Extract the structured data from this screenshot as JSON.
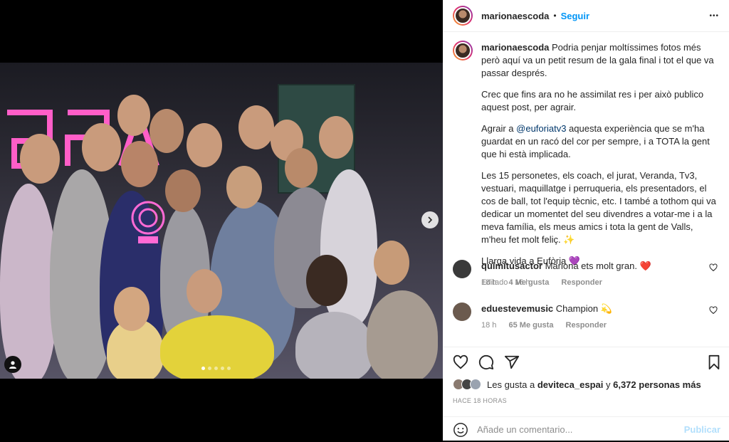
{
  "post": {
    "username": "marionaescoda",
    "dot": "•",
    "follow_label": "Seguir",
    "more_label": "•••"
  },
  "caption": {
    "username": "marionaescoda",
    "p1": "Podria penjar moltíssimes fotos més però aquí va un petit resum de la gala final i tot el que va passar després.",
    "p2": "Crec que fins ara no he assimilat res i per això publico aquest post, per agrair.",
    "p3_pre": "Agrair a ",
    "p3_link": "@euforiatv3",
    "p3_post": " aquesta experiència que se m'ha guardat en un racó del cor per sempre, i a TOTA la gent que hi està implicada.",
    "p4": "Les 15 personetes, els coach, el jurat, Veranda, Tv3, vestuari, maquillatge i perruqueria, els presentadors, el cos de ball, tot l'equip tècnic, etc. I també a tothom qui va dedicar un momentet del seu divendres a votar-me i a la meva família, els meus amics i tota la gent de Valls, m'heu fet molt feliç. ✨",
    "p5": "Llarga vida a Eufòria 💜",
    "edited": "Editado · 16 h"
  },
  "comments": [
    {
      "username": "quimitusactor",
      "text": "Mariona ets molt gran. ❤️",
      "time": "18 h",
      "likes": "4 Me gusta",
      "reply": "Responder",
      "avatar_color": "#3a3a3a"
    },
    {
      "username": "eduestevemusic",
      "text": "Champion 💫",
      "time": "18 h",
      "likes": "65 Me gusta",
      "reply": "Responder",
      "avatar_color": "#6b5a4e"
    }
  ],
  "likes_row": {
    "prefix": "Les gusta a ",
    "user": "deviteca_espai",
    "mid": " y ",
    "count": "6,372 personas más"
  },
  "timestamp": "HACE 18 HORAS",
  "add_comment": {
    "placeholder": "Añade un comentario...",
    "publish": "Publicar"
  },
  "icons": {
    "like": "heart-icon",
    "comment": "comment-icon",
    "share": "share-icon",
    "save": "bookmark-icon",
    "emoji": "emoji-icon",
    "next": "chevron-right-icon",
    "tag": "user-tag-icon"
  },
  "colors": {
    "link": "#00376b",
    "follow": "#0095f6",
    "publish_disabled": "#b2dffc"
  }
}
